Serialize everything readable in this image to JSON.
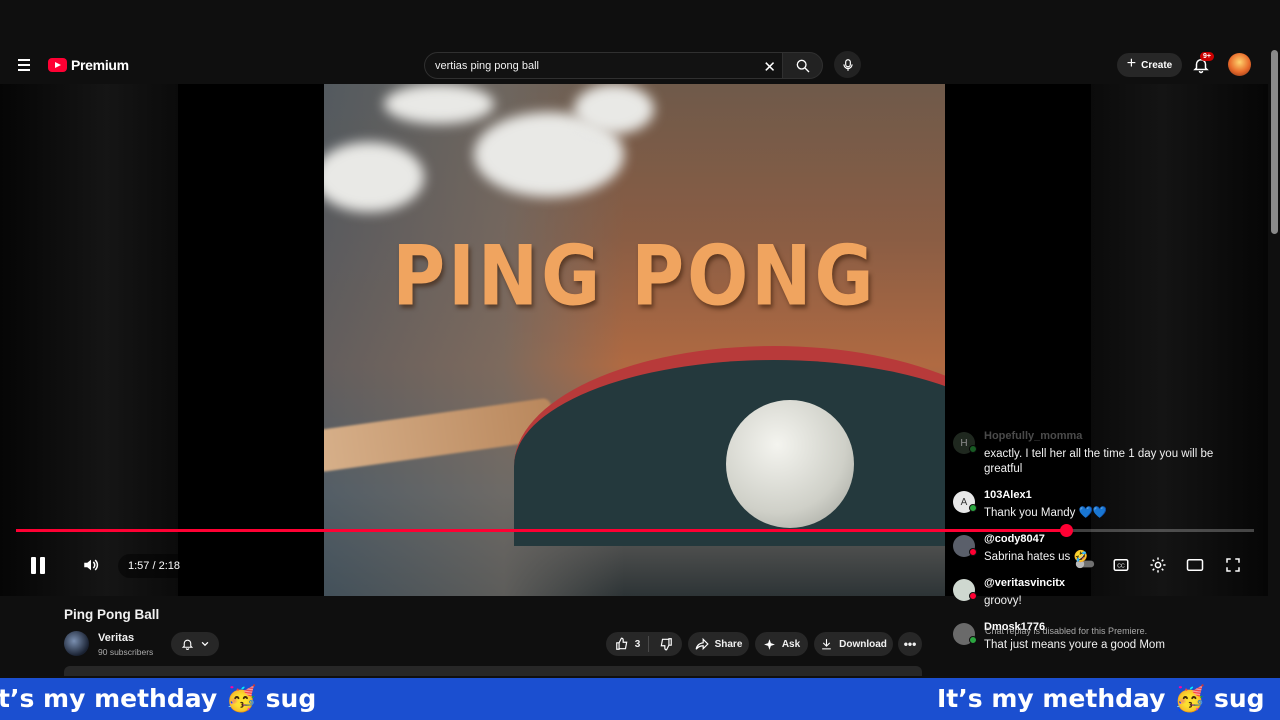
{
  "masthead": {
    "logo_text": "Premium",
    "search_value": "vertias ping pong ball",
    "create_label": "Create",
    "notification_badge": "9+"
  },
  "player": {
    "video_overlay_text": "PING PONG",
    "time_display": "1:57 / 2:18",
    "progress_fraction": 0.8485,
    "accent_color": "#ff0033"
  },
  "chat": {
    "messages": [
      {
        "author": "Hopefully_momma",
        "text": "exactly. I tell her all the time 1 day you will be greatful",
        "initial": "H"
      },
      {
        "author": "103Alex1",
        "text": "Thank you Mandy 💙💙",
        "initial": "A"
      },
      {
        "author": "@cody8047",
        "text": "Sabrina hates us 🤣",
        "initial": ""
      },
      {
        "author": "@veritasvincitx",
        "text": "groovy!",
        "initial": ""
      },
      {
        "author": "Dmosk1776",
        "text": "That just means youre a good Mom",
        "initial": ""
      }
    ],
    "disabled_note": "Chat replay is disabled for this Premiere."
  },
  "video_info": {
    "title": "Ping Pong Ball",
    "channel_name": "Veritas",
    "subscribers": "90 subscribers",
    "like_count": "3",
    "share_label": "Share",
    "ask_label": "Ask",
    "download_label": "Download"
  },
  "ticker": {
    "text_left": "t’s my methday 🥳 sug",
    "text_right": "It’s my methday 🥳 sug"
  }
}
